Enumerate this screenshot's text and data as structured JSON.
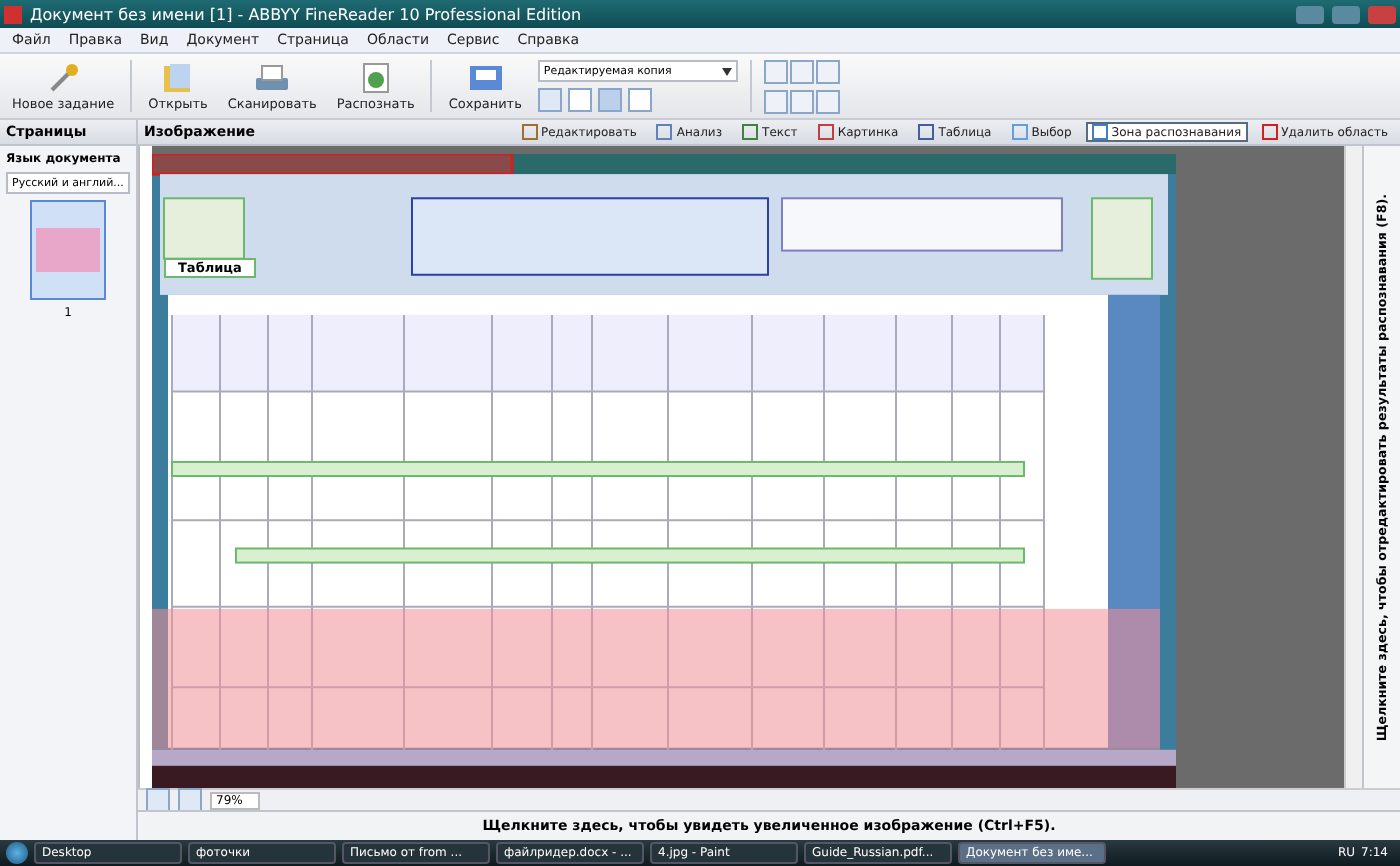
{
  "window": {
    "title": "Документ без имени [1] - ABBYY FineReader 10 Professional Edition"
  },
  "menu": [
    "Файл",
    "Правка",
    "Вид",
    "Документ",
    "Страница",
    "Области",
    "Сервис",
    "Справка"
  ],
  "toolbar": {
    "buttons": [
      {
        "label": "Новое задание",
        "kind": "wand"
      },
      {
        "label": "Открыть",
        "kind": "folder"
      },
      {
        "label": "Сканировать",
        "kind": "scanner"
      },
      {
        "label": "Распознать",
        "kind": "recognize"
      }
    ],
    "save": {
      "label": "Сохранить"
    },
    "format": {
      "value": "Редактируемая копия"
    }
  },
  "pages_panel": {
    "title": "Страницы",
    "language_label": "Язык документа",
    "language": "Русский и англий...",
    "pages": [
      {
        "number": "1",
        "selected": true
      }
    ]
  },
  "image_panel": {
    "title": "Изображение",
    "tools": [
      {
        "label": "Редактировать",
        "kind": "edit",
        "selected": false
      },
      {
        "label": "Анализ",
        "kind": "analyze",
        "selected": false
      },
      {
        "label": "Текст",
        "kind": "text",
        "selected": false
      },
      {
        "label": "Картинка",
        "kind": "picture",
        "selected": false
      },
      {
        "label": "Таблица",
        "kind": "table",
        "selected": false
      },
      {
        "label": "Выбор",
        "kind": "select",
        "selected": false
      },
      {
        "label": "Зона распознавания",
        "kind": "zone",
        "selected": true
      },
      {
        "label": "Удалить область",
        "kind": "delete",
        "selected": false
      }
    ],
    "zones": [
      {
        "label": "Таблица"
      }
    ],
    "zoom": "79%",
    "right_hint": "Щелкните здесь, чтобы отредактировать результаты распознавания (F8).",
    "bottom_hint": "Щелкните здесь, чтобы увидеть увеличенное изображение (Ctrl+F5)."
  },
  "taskbar": {
    "items": [
      {
        "label": "Desktop",
        "active": false
      },
      {
        "label": "фоточки",
        "active": false
      },
      {
        "label": "Письмо от from ...",
        "active": false
      },
      {
        "label": "файлридер.docx - ...",
        "active": false
      },
      {
        "label": "4.jpg - Paint",
        "active": false
      },
      {
        "label": "Guide_Russian.pdf...",
        "active": false
      },
      {
        "label": "Документ без име...",
        "active": true
      }
    ],
    "language": "RU",
    "time": "7:14"
  }
}
